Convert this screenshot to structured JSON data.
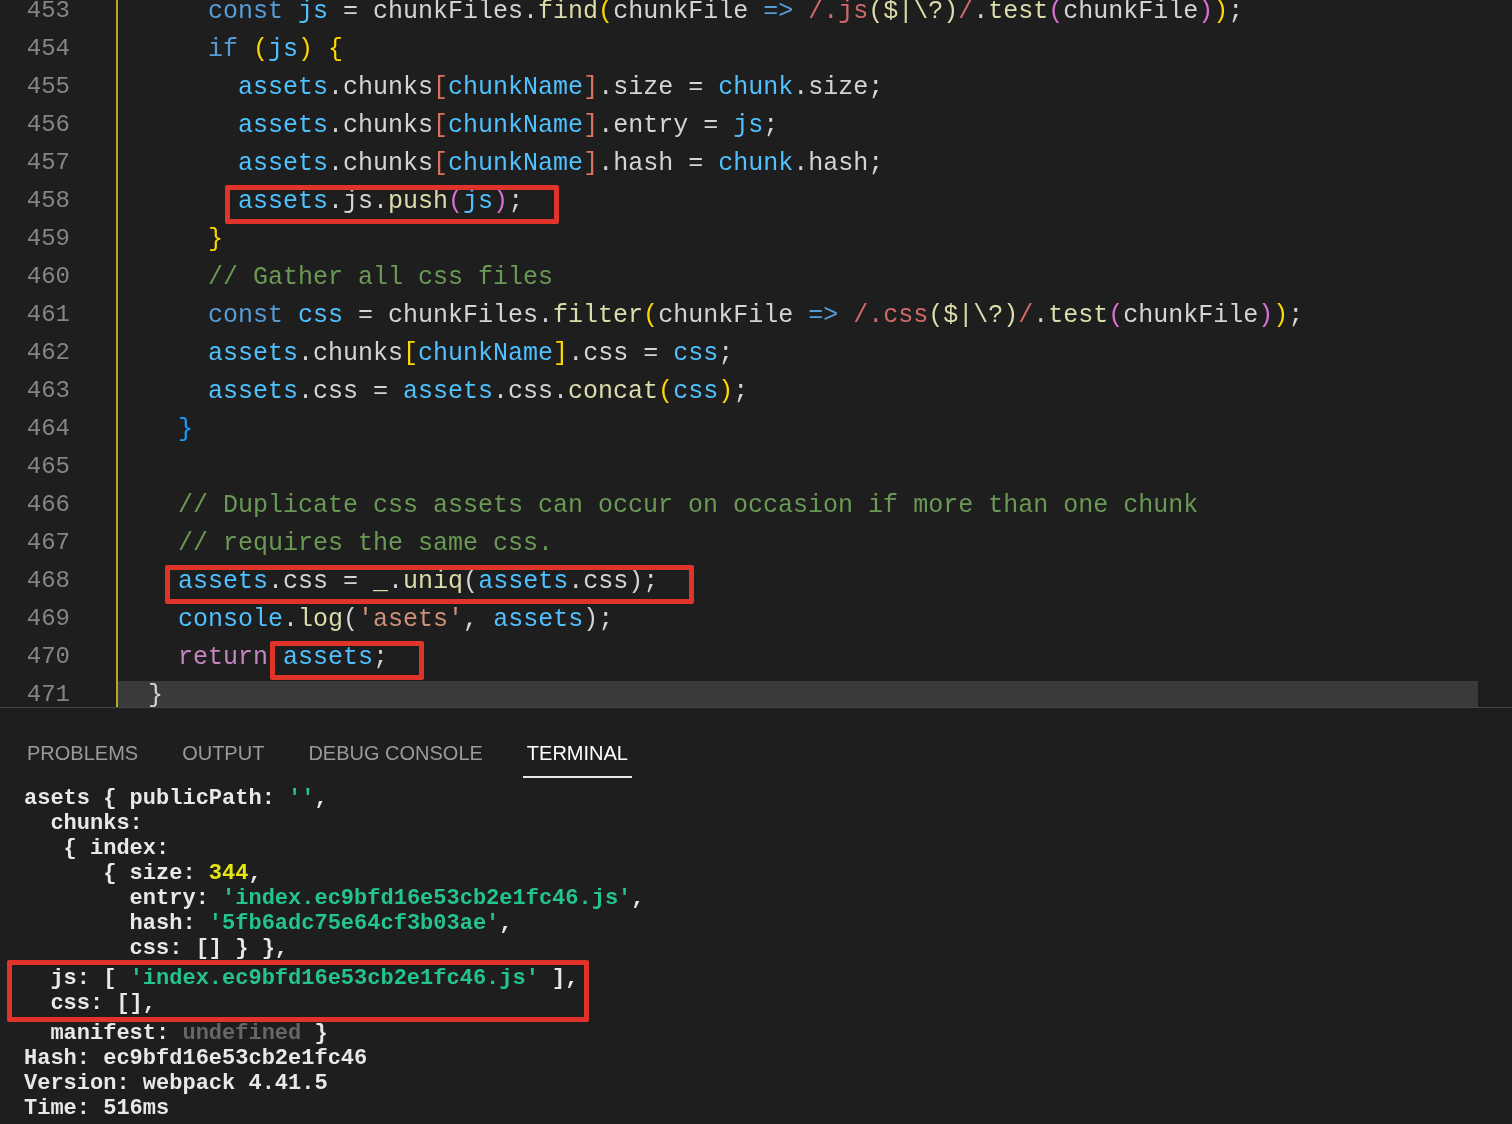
{
  "editor": {
    "lines": [
      {
        "number": "453",
        "tokens": [
          {
            "text": "      const",
            "kind": "keyword"
          },
          {
            "text": " js",
            "kind": "variable"
          },
          {
            "text": " = chunkFiles.",
            "kind": "plain"
          },
          {
            "text": "find",
            "kind": "function"
          },
          {
            "text": "(",
            "kind": "bracket1"
          },
          {
            "text": "chunkFile ",
            "kind": "plain"
          },
          {
            "text": "=>",
            "kind": "keyword"
          },
          {
            "text": " /.js",
            "kind": "regex"
          },
          {
            "text": "($|\\?)",
            "kind": "function"
          },
          {
            "text": "/",
            "kind": "regex"
          },
          {
            "text": ".",
            "kind": "plain"
          },
          {
            "text": "test",
            "kind": "function"
          },
          {
            "text": "(",
            "kind": "bracket2"
          },
          {
            "text": "chunkFile",
            "kind": "plain"
          },
          {
            "text": ")",
            "kind": "bracket2"
          },
          {
            "text": ")",
            "kind": "bracket1"
          },
          {
            "text": ";",
            "kind": "plain"
          }
        ]
      },
      {
        "number": "454",
        "tokens": [
          {
            "text": "      if",
            "kind": "keyword"
          },
          {
            "text": " (",
            "kind": "bracket1"
          },
          {
            "text": "js",
            "kind": "variable"
          },
          {
            "text": ") {",
            "kind": "bracket1"
          }
        ]
      },
      {
        "number": "455",
        "tokens": [
          {
            "text": "        assets",
            "kind": "variable"
          },
          {
            "text": ".chunks",
            "kind": "plain"
          },
          {
            "text": "[",
            "kind": "bracket4"
          },
          {
            "text": "chunkName",
            "kind": "variable"
          },
          {
            "text": "]",
            "kind": "bracket4"
          },
          {
            "text": ".size = ",
            "kind": "plain"
          },
          {
            "text": "chunk",
            "kind": "variable"
          },
          {
            "text": ".size;",
            "kind": "plain"
          }
        ]
      },
      {
        "number": "456",
        "tokens": [
          {
            "text": "        assets",
            "kind": "variable"
          },
          {
            "text": ".chunks",
            "kind": "plain"
          },
          {
            "text": "[",
            "kind": "bracket4"
          },
          {
            "text": "chunkName",
            "kind": "variable"
          },
          {
            "text": "]",
            "kind": "bracket4"
          },
          {
            "text": ".entry = ",
            "kind": "plain"
          },
          {
            "text": "js",
            "kind": "variable"
          },
          {
            "text": ";",
            "kind": "plain"
          }
        ]
      },
      {
        "number": "457",
        "tokens": [
          {
            "text": "        assets",
            "kind": "variable"
          },
          {
            "text": ".chunks",
            "kind": "plain"
          },
          {
            "text": "[",
            "kind": "bracket4"
          },
          {
            "text": "chunkName",
            "kind": "variable"
          },
          {
            "text": "]",
            "kind": "bracket4"
          },
          {
            "text": ".hash = ",
            "kind": "plain"
          },
          {
            "text": "chunk",
            "kind": "variable"
          },
          {
            "text": ".hash;",
            "kind": "plain"
          }
        ]
      },
      {
        "number": "458",
        "marked": [
          {
            "text": "        assets",
            "kind": "variable"
          },
          {
            "text": ".js.",
            "kind": "plain"
          },
          {
            "text": "push",
            "kind": "function"
          },
          {
            "text": "(",
            "kind": "bracket2"
          },
          {
            "text": "js",
            "kind": "variable"
          },
          {
            "text": ")",
            "kind": "bracket2"
          },
          {
            "text": ";",
            "kind": "plain"
          }
        ]
      },
      {
        "number": "459",
        "tokens": [
          {
            "text": "      }",
            "kind": "bracket1"
          }
        ]
      },
      {
        "number": "460",
        "tokens": [
          {
            "text": "      // Gather all css files",
            "kind": "comment"
          }
        ]
      },
      {
        "number": "461",
        "tokens": [
          {
            "text": "      const",
            "kind": "keyword"
          },
          {
            "text": " css",
            "kind": "variable"
          },
          {
            "text": " = chunkFiles.",
            "kind": "plain"
          },
          {
            "text": "filter",
            "kind": "function"
          },
          {
            "text": "(",
            "kind": "bracket1"
          },
          {
            "text": "chunkFile ",
            "kind": "plain"
          },
          {
            "text": "=>",
            "kind": "keyword"
          },
          {
            "text": " /.css",
            "kind": "regex"
          },
          {
            "text": "($|\\?)",
            "kind": "function"
          },
          {
            "text": "/",
            "kind": "regex"
          },
          {
            "text": ".",
            "kind": "plain"
          },
          {
            "text": "test",
            "kind": "function"
          },
          {
            "text": "(",
            "kind": "bracket2"
          },
          {
            "text": "chunkFile",
            "kind": "plain"
          },
          {
            "text": ")",
            "kind": "bracket2"
          },
          {
            "text": ")",
            "kind": "bracket1"
          },
          {
            "text": ";",
            "kind": "plain"
          }
        ]
      },
      {
        "number": "462",
        "tokens": [
          {
            "text": "      assets",
            "kind": "variable"
          },
          {
            "text": ".chunks",
            "kind": "plain"
          },
          {
            "text": "[",
            "kind": "bracket1"
          },
          {
            "text": "chunkName",
            "kind": "variable"
          },
          {
            "text": "]",
            "kind": "bracket1"
          },
          {
            "text": ".css = ",
            "kind": "plain"
          },
          {
            "text": "css",
            "kind": "variable"
          },
          {
            "text": ";",
            "kind": "plain"
          }
        ]
      },
      {
        "number": "463",
        "tokens": [
          {
            "text": "      assets",
            "kind": "variable"
          },
          {
            "text": ".css = ",
            "kind": "plain"
          },
          {
            "text": "assets",
            "kind": "variable"
          },
          {
            "text": ".css.",
            "kind": "plain"
          },
          {
            "text": "concat",
            "kind": "function"
          },
          {
            "text": "(",
            "kind": "bracket1"
          },
          {
            "text": "css",
            "kind": "variable"
          },
          {
            "text": ")",
            "kind": "bracket1"
          },
          {
            "text": ";",
            "kind": "plain"
          }
        ]
      },
      {
        "number": "464",
        "tokens": [
          {
            "text": "    }",
            "kind": "bracket3"
          }
        ]
      },
      {
        "number": "465"
      },
      {
        "number": "466",
        "tokens": [
          {
            "text": "    // Duplicate css assets can occur on occasion if more than one chunk",
            "kind": "comment"
          }
        ]
      },
      {
        "number": "467",
        "tokens": [
          {
            "text": "    // requires the same css.",
            "kind": "comment"
          }
        ]
      },
      {
        "number": "468",
        "marked": [
          {
            "text": "    assets",
            "kind": "variable"
          },
          {
            "text": ".css = ",
            "kind": "plain"
          },
          {
            "text": "_",
            "kind": "function"
          },
          {
            "text": ".",
            "kind": "plain"
          },
          {
            "text": "uniq",
            "kind": "function"
          },
          {
            "text": "(",
            "kind": "plain"
          },
          {
            "text": "assets",
            "kind": "variable"
          },
          {
            "text": ".css);",
            "kind": "plain"
          }
        ]
      },
      {
        "number": "469",
        "tokens": [
          {
            "text": "    console",
            "kind": "variable"
          },
          {
            "text": ".",
            "kind": "plain"
          },
          {
            "text": "log",
            "kind": "function"
          },
          {
            "text": "(",
            "kind": "plain"
          },
          {
            "text": "'asets'",
            "kind": "string"
          },
          {
            "text": ", ",
            "kind": "plain"
          },
          {
            "text": "assets",
            "kind": "variable"
          },
          {
            "text": ");",
            "kind": "plain"
          }
        ]
      },
      {
        "number": "470",
        "tokens": [
          {
            "text": "    return",
            "kind": "control"
          }
        ],
        "marked": [
          {
            "text": " assets",
            "kind": "variable"
          },
          {
            "text": ";",
            "kind": "plain"
          }
        ]
      },
      {
        "number": "471",
        "current": true,
        "tokens": [
          {
            "text": "  }",
            "kind": "plain"
          }
        ]
      }
    ]
  },
  "panel": {
    "tabs": [
      {
        "label": "PROBLEMS",
        "selected": false
      },
      {
        "label": "OUTPUT",
        "selected": false
      },
      {
        "label": "DEBUG CONSOLE",
        "selected": false
      },
      {
        "label": "TERMINAL",
        "selected": true
      }
    ],
    "terminal": [
      {
        "highlighted": false,
        "tokens": [
          {
            "text": "asets { publicPath: ",
            "kind": "plain"
          },
          {
            "text": "''",
            "kind": "string"
          },
          {
            "text": ",",
            "kind": "plain"
          }
        ]
      },
      {
        "highlighted": false,
        "tokens": [
          {
            "text": "  chunks:",
            "kind": "plain"
          }
        ]
      },
      {
        "highlighted": false,
        "tokens": [
          {
            "text": "   { index:",
            "kind": "plain"
          }
        ]
      },
      {
        "highlighted": false,
        "tokens": [
          {
            "text": "      { size: ",
            "kind": "plain"
          },
          {
            "text": "344",
            "kind": "number"
          },
          {
            "text": ",",
            "kind": "plain"
          }
        ]
      },
      {
        "highlighted": false,
        "tokens": [
          {
            "text": "        entry: ",
            "kind": "plain"
          },
          {
            "text": "'index.ec9bfd16e53cb2e1fc46.js'",
            "kind": "string"
          },
          {
            "text": ",",
            "kind": "plain"
          }
        ]
      },
      {
        "highlighted": false,
        "tokens": [
          {
            "text": "        hash: ",
            "kind": "plain"
          },
          {
            "text": "'5fb6adc75e64cf3b03ae'",
            "kind": "string"
          },
          {
            "text": ",",
            "kind": "plain"
          }
        ]
      },
      {
        "highlighted": false,
        "tokens": [
          {
            "text": "        css: [] } },",
            "kind": "plain"
          }
        ]
      },
      {
        "highlighted": true,
        "tokens": [
          {
            "text": "  js: [ ",
            "kind": "plain"
          },
          {
            "text": "'index.ec9bfd16e53cb2e1fc46.js'",
            "kind": "string"
          },
          {
            "text": " ],",
            "kind": "plain"
          }
        ]
      },
      {
        "highlighted": true,
        "tokens": [
          {
            "text": "  css: [],",
            "kind": "plain"
          }
        ]
      },
      {
        "highlighted": false,
        "tokens": [
          {
            "text": "  manifest: ",
            "kind": "plain"
          },
          {
            "text": "undefined",
            "kind": "muted"
          },
          {
            "text": " }",
            "kind": "plain"
          }
        ]
      },
      {
        "highlighted": false,
        "tokens": [
          {
            "text": "Hash: ec9bfd16e53cb2e1fc46",
            "kind": "plain"
          }
        ]
      },
      {
        "highlighted": false,
        "tokens": [
          {
            "text": "Version: webpack 4.41.5",
            "kind": "plain"
          }
        ]
      },
      {
        "highlighted": false,
        "tokens": [
          {
            "text": "Time: 516ms",
            "kind": "plain"
          }
        ]
      }
    ]
  }
}
